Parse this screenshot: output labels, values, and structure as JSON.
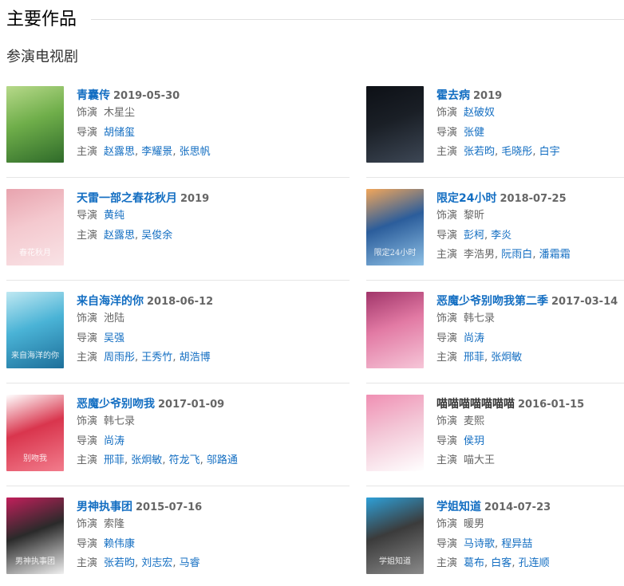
{
  "section_title": "主要作品",
  "sub_title": "参演电视剧",
  "labels": {
    "role": "饰演",
    "director": "导演",
    "cast": "主演"
  },
  "works": [
    {
      "title": "青囊传",
      "date": "2019-05-30",
      "role": "木星尘",
      "role_link": false,
      "directors": [
        "胡储玺"
      ],
      "cast": [
        "赵露思",
        "李耀景",
        "张思帆"
      ],
      "cast_links": [
        true,
        true,
        true
      ],
      "poster": {
        "colors": [
          "#6fae4a",
          "#2f6b2a",
          "#b7d98a"
        ],
        "caption": ""
      }
    },
    {
      "title": "霍去病",
      "date": "2019",
      "role": "赵破奴",
      "role_link": true,
      "directors": [
        "张健"
      ],
      "cast": [
        "张若昀",
        "毛晓彤",
        "白宇"
      ],
      "cast_links": [
        true,
        true,
        true
      ],
      "poster": {
        "colors": [
          "#1a1f26",
          "#3d4755",
          "#0d1016"
        ],
        "caption": ""
      }
    },
    {
      "title": "天雷一部之春花秋月",
      "date": "2019",
      "role": null,
      "directors": [
        "黄纯"
      ],
      "cast": [
        "赵露思",
        "吴俊余"
      ],
      "cast_links": [
        true,
        true
      ],
      "poster": {
        "colors": [
          "#f4c9cf",
          "#f9e3e6",
          "#e8a3ae"
        ],
        "caption": "春花秋月"
      }
    },
    {
      "title": "限定24小时",
      "date": "2018-07-25",
      "role": "黎昕",
      "role_link": false,
      "directors": [
        "彭柯",
        "李炎"
      ],
      "cast": [
        "李浩男",
        "阮雨白",
        "潘霜霜"
      ],
      "cast_links": [
        false,
        true,
        true
      ],
      "poster": {
        "colors": [
          "#2b5d9b",
          "#8fc1e6",
          "#f2a65a"
        ],
        "caption": "限定24小时"
      }
    },
    {
      "title": "来自海洋的你",
      "date": "2018-06-12",
      "role": "池陆",
      "role_link": false,
      "directors": [
        "吴强"
      ],
      "cast": [
        "周雨彤",
        "王秀竹",
        "胡浩博"
      ],
      "cast_links": [
        true,
        true,
        true
      ],
      "poster": {
        "colors": [
          "#4ab3d6",
          "#1d6f9a",
          "#bfe8f2"
        ],
        "caption": "来自海洋的你"
      }
    },
    {
      "title": "恶魔少爷别吻我第二季",
      "date": "2017-03-14",
      "role": "韩七录",
      "role_link": false,
      "directors": [
        "尚涛"
      ],
      "cast": [
        "邢菲",
        "张炯敏"
      ],
      "cast_links": [
        true,
        true
      ],
      "poster": {
        "colors": [
          "#e27aa4",
          "#f6c6d8",
          "#a1356a"
        ],
        "caption": ""
      }
    },
    {
      "title": "恶魔少爷别吻我",
      "date": "2017-01-09",
      "role": "韩七录",
      "role_link": false,
      "directors": [
        "尚涛"
      ],
      "cast": [
        "邢菲",
        "张炯敏",
        "符龙飞",
        "邬路通"
      ],
      "cast_links": [
        true,
        true,
        true,
        true
      ],
      "poster": {
        "colors": [
          "#d9354d",
          "#f27c8c",
          "#ffffff"
        ],
        "caption": "别吻我"
      }
    },
    {
      "title": "喵喵喵喵喵喵喵",
      "date": "2016-01-15",
      "role": "麦熙",
      "role_link": false,
      "directors": [
        "侯玥"
      ],
      "cast": [
        "喵大王"
      ],
      "cast_links": [
        false
      ],
      "title_dark": true,
      "poster": {
        "colors": [
          "#f3c6d6",
          "#ffffff",
          "#f08fb3"
        ],
        "caption": ""
      }
    },
    {
      "title": "男神执事团",
      "date": "2015-07-16",
      "role": "索隆",
      "role_link": false,
      "directors": [
        "赖伟康"
      ],
      "cast": [
        "张若昀",
        "刘志宏",
        "马睿"
      ],
      "cast_links": [
        true,
        true,
        true
      ],
      "poster": {
        "colors": [
          "#2a2a2a",
          "#f0f0f0",
          "#c21f5b"
        ],
        "caption": "男神执事团"
      }
    },
    {
      "title": "学姐知道",
      "date": "2014-07-23",
      "role": "暖男",
      "role_link": false,
      "directors": [
        "马诗歌",
        "程异喆"
      ],
      "cast": [
        "葛布",
        "白客",
        "孔连顺"
      ],
      "cast_links": [
        true,
        true,
        true
      ],
      "poster": {
        "colors": [
          "#3b3b3b",
          "#8a8a8a",
          "#2ea0d8"
        ],
        "caption": "学姐知道"
      }
    }
  ]
}
